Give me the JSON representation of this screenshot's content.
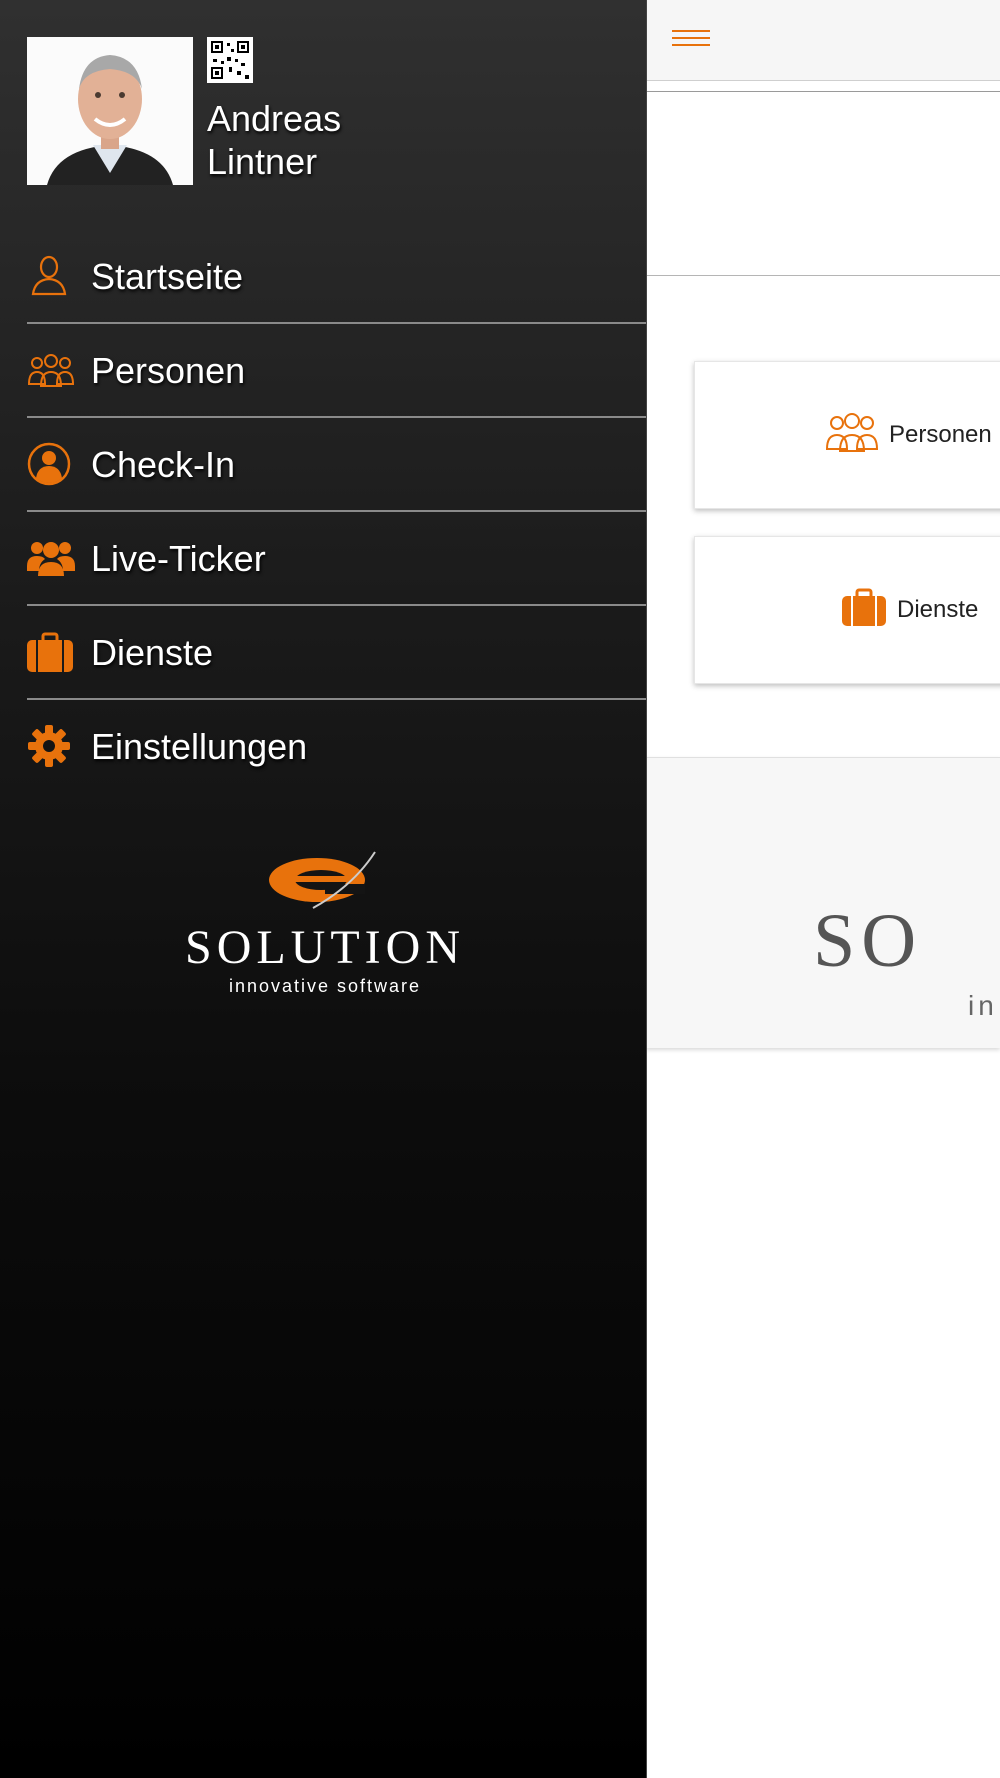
{
  "colors": {
    "accent": "#e8720c",
    "drawer_bg": "#1a1a1a",
    "text_light": "#ffffff"
  },
  "user": {
    "first_name": "Andreas",
    "last_name": "Lintner"
  },
  "menu": {
    "items": [
      {
        "label": "Startseite",
        "icon": "person-outline-icon"
      },
      {
        "label": "Personen",
        "icon": "people-outline-icon"
      },
      {
        "label": "Check-In",
        "icon": "person-circle-icon"
      },
      {
        "label": "Live-Ticker",
        "icon": "group-filled-icon"
      },
      {
        "label": "Dienste",
        "icon": "briefcase-icon"
      },
      {
        "label": "Einstellungen",
        "icon": "gear-icon"
      }
    ]
  },
  "brand": {
    "word": "SOLUTION",
    "tagline": "innovative software"
  },
  "main": {
    "cards": [
      {
        "label": "Personen",
        "icon": "people-outline-icon"
      },
      {
        "label": "Dienste",
        "icon": "briefcase-icon"
      }
    ],
    "footer_logo_partial": "SO",
    "footer_sub_partial": "in"
  }
}
